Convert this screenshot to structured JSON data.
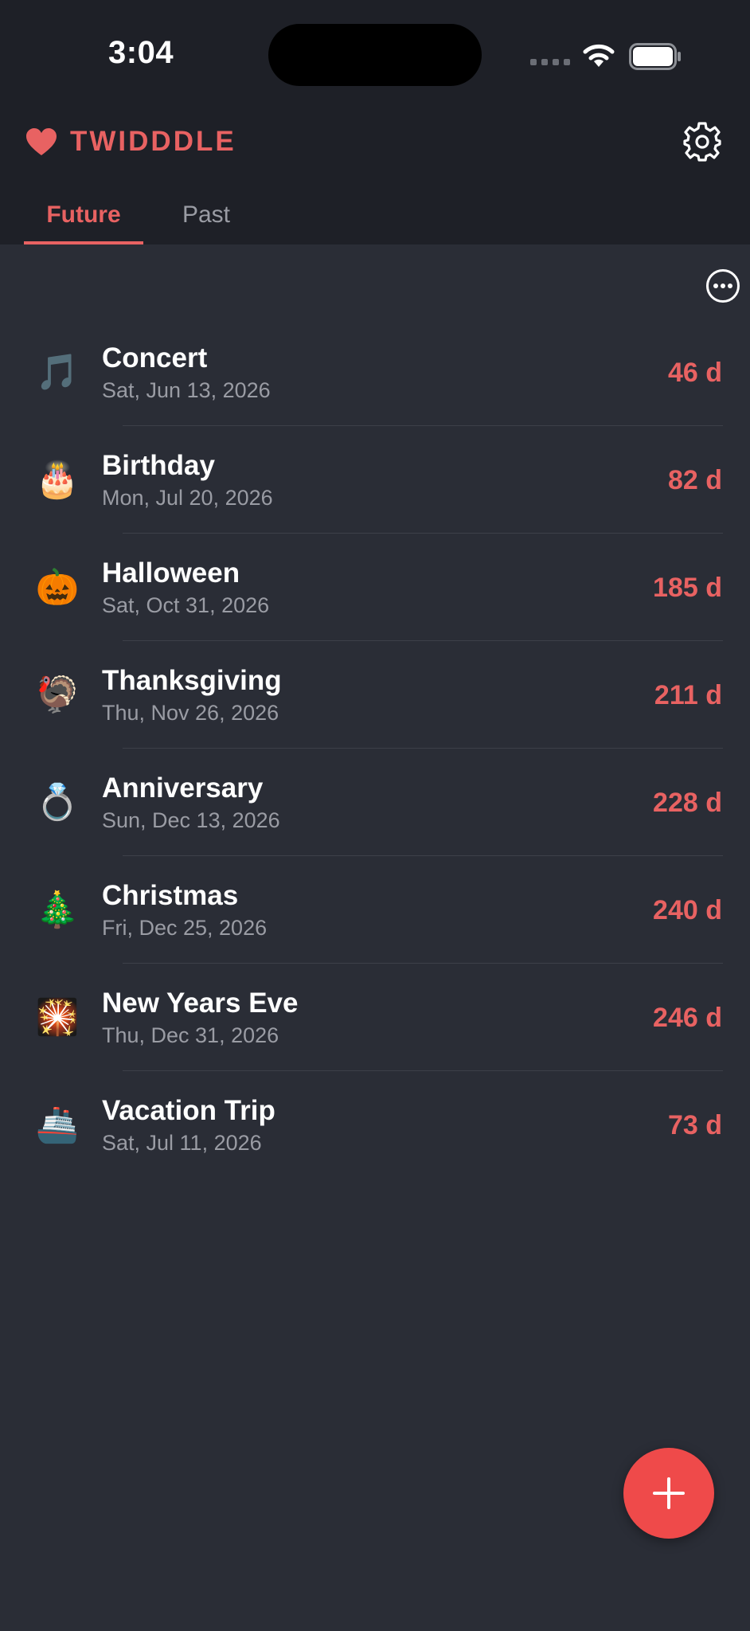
{
  "status_bar": {
    "time": "3:04"
  },
  "app": {
    "name": "TWIDDDLE",
    "accent": "#e86262"
  },
  "tabs": [
    {
      "label": "Future",
      "active": true
    },
    {
      "label": "Past",
      "active": false
    }
  ],
  "events": [
    {
      "icon": "musical-notes",
      "emoji": "🎵",
      "name": "Concert",
      "date": "Sat, Jun 13, 2026",
      "count": "46 d"
    },
    {
      "icon": "birthday-cake",
      "emoji": "🎂",
      "name": "Birthday",
      "date": "Mon, Jul 20, 2026",
      "count": "82 d"
    },
    {
      "icon": "jack-o-lantern",
      "emoji": "🎃",
      "name": "Halloween",
      "date": "Sat, Oct 31, 2026",
      "count": "185 d"
    },
    {
      "icon": "turkey",
      "emoji": "🦃",
      "name": "Thanksgiving",
      "date": "Thu, Nov 26, 2026",
      "count": "211 d"
    },
    {
      "icon": "ring",
      "emoji": "💍",
      "name": "Anniversary",
      "date": "Sun, Dec 13, 2026",
      "count": "228 d"
    },
    {
      "icon": "christmas-tree",
      "emoji": "🎄",
      "name": "Christmas",
      "date": "Fri, Dec 25, 2026",
      "count": "240 d"
    },
    {
      "icon": "fireworks",
      "emoji": "🎇",
      "name": "New Years Eve",
      "date": "Thu, Dec 31, 2026",
      "count": "246 d"
    },
    {
      "icon": "ship",
      "emoji": "🚢",
      "name": "Vacation Trip",
      "date": "Sat, Jul 11, 2026",
      "count": "73 d"
    }
  ]
}
